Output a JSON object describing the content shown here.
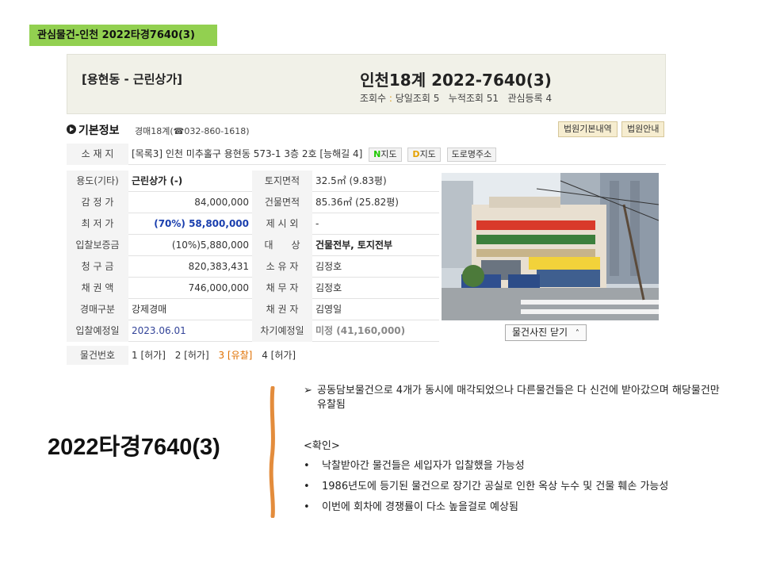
{
  "tag": "관심물건-인천 2022타경7640(3)",
  "header": {
    "left": "[용현동 - 근린상가]",
    "title": "인천18계 2022-7640(3)",
    "stats_prefix": "조회수",
    "stats_sep": ":",
    "stats": "당일조회 5   누적조회 51   관심등록 4"
  },
  "basic": {
    "title": "기본정보",
    "court": "경매18계(☎032-860-1618)",
    "btn_court": "법원기본내역",
    "btn_guide": "법원안내"
  },
  "location": {
    "label": "소 재 지",
    "value": "[목록3] 인천 미추홀구 용현동 573-1 3층 2호 [능해길 4]",
    "chip_naver_logo": "N",
    "chip_naver": "지도",
    "chip_daum_logo": "D",
    "chip_daum": "지도",
    "chip_road": "도로명주소"
  },
  "rows": [
    {
      "l1": "용도(기타)",
      "v1": "근린상가 (-)",
      "l2": "토지면적",
      "v2": "32.5㎡ (9.83평)"
    },
    {
      "l1": "감 정 가",
      "v1": "84,000,000",
      "l2": "건물면적",
      "v2": "85.36㎡ (25.82평)"
    },
    {
      "l1": "최 저 가",
      "v1": "(70%) 58,800,000",
      "l2": "제 시 외",
      "v2": "-"
    },
    {
      "l1": "입찰보증금",
      "v1": "(10%)5,880,000",
      "l2": "대      상",
      "v2": "건물전부, 토지전부"
    },
    {
      "l1": "청 구 금",
      "v1": "820,383,431",
      "l2": "소 유 자",
      "v2": "김정호"
    },
    {
      "l1": "채 권 액",
      "v1": "746,000,000",
      "l2": "채 무 자",
      "v2": "김정호"
    },
    {
      "l1": "경매구분",
      "v1": "강제경매",
      "l2": "채 권 자",
      "v2": "김영일"
    },
    {
      "l1": "입찰예정일",
      "v1": "2023.06.01",
      "l2": "차기예정일",
      "v2": "미정 (41,160,000)"
    }
  ],
  "items": {
    "label": "물건번호",
    "list": [
      "1 [허가]",
      "2 [허가]",
      "3 [유찰]",
      "4 [허가]"
    ]
  },
  "photo_btn": "물건사진 닫기",
  "big_title": "2022타경7640(3)",
  "notes": {
    "arrow_text": "공동담보물건으로 4개가 동시에 매각되었으나 다른물건들은 다 신건에 받아갔으며 해당물건만 유찰됨",
    "confirm": "<확인>",
    "bullets": [
      "낙찰받아간 물건들은 세입자가 입찰했을 가능성",
      "1986년도에 등기된 물건으로 장기간 공실로 인한 옥상 누수 및 건물 훼손 가능성",
      "이번에 회차에 경쟁률이 다소 높을걸로 예상됨"
    ]
  },
  "colors": {
    "tag_bg": "#92d050",
    "header_bg": "#f1f1e8",
    "line_orange": "#e38c3c",
    "min_price": "#1a3fae"
  }
}
